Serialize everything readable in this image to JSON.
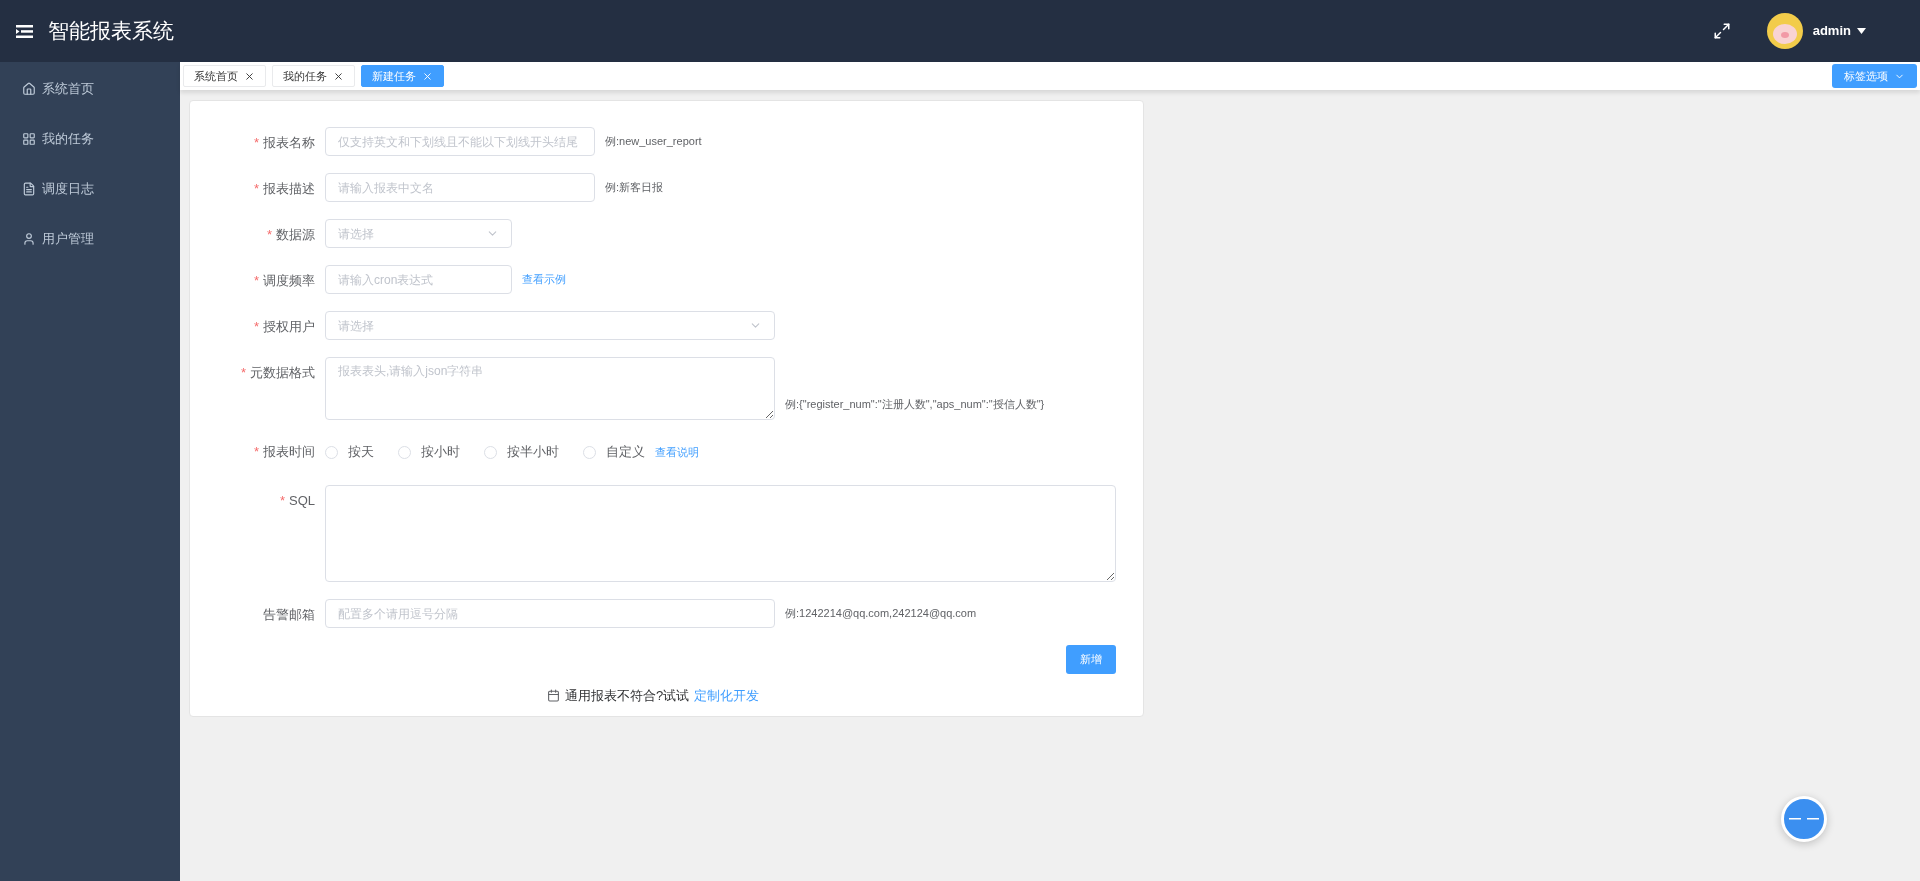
{
  "header": {
    "title": "智能报表系统",
    "user": "admin"
  },
  "sidebar": {
    "items": [
      {
        "label": "系统首页",
        "selected": false
      },
      {
        "label": "我的任务",
        "selected": false
      },
      {
        "label": "调度日志",
        "selected": false
      },
      {
        "label": "用户管理",
        "selected": false
      }
    ]
  },
  "tabs": [
    {
      "label": "系统首页",
      "selected": false
    },
    {
      "label": "我的任务",
      "selected": false
    },
    {
      "label": "新建任务",
      "selected": true
    }
  ],
  "tab_options": "标签选项",
  "form": {
    "fields": [
      {
        "kind": "input",
        "label": "报表名称",
        "required_mark": "*",
        "placeholder": "仅支持英文和下划线且不能以下划线开头结尾",
        "hint": "例:new_user_report"
      },
      {
        "kind": "input",
        "label": "报表描述",
        "required_mark": "*",
        "placeholder": "请输入报表中文名",
        "hint": "例:新客日报"
      },
      {
        "kind": "select",
        "label": "数据源",
        "required_mark": "*",
        "placeholder": "请选择"
      },
      {
        "kind": "input",
        "label": "调度频率",
        "required_mark": "*",
        "placeholder": "请输入cron表达式",
        "link": "查看示例"
      },
      {
        "kind": "select",
        "label": "授权用户",
        "required_mark": "*",
        "placeholder": "请选择"
      },
      {
        "kind": "textarea",
        "label": "元数据格式",
        "required_mark": "*",
        "placeholder": "报表表头,请输入json字符串",
        "hint": "例:{\"register_num\":\"注册人数\",\"aps_num\":\"授信人数\"}"
      },
      {
        "kind": "radio",
        "label": "报表时间",
        "required_mark": "*",
        "options": [
          {
            "label": "按天",
            "selected": false
          },
          {
            "label": "按小时",
            "selected": false
          },
          {
            "label": "按半小时",
            "selected": false
          },
          {
            "label": "自定义",
            "selected": false
          }
        ],
        "link": "查看说明"
      },
      {
        "kind": "textarea",
        "label": "SQL",
        "required_mark": "*"
      },
      {
        "kind": "input",
        "label": "告警邮箱",
        "placeholder": "配置多个请用逗号分隔",
        "hint": "例:1242214@qq.com,242124@qq.com"
      }
    ],
    "submit": "新增",
    "footer_text": "通用报表不符合?试试",
    "footer_link": "定制化开发"
  }
}
